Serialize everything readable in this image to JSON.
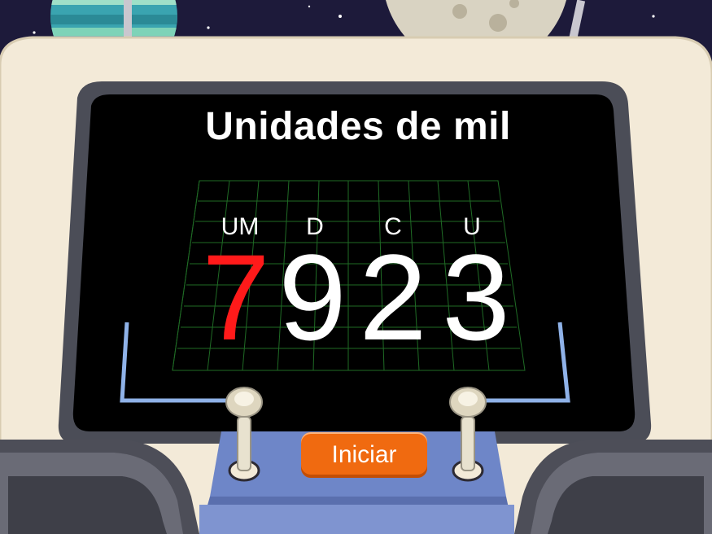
{
  "screen": {
    "title": "Unidades de mil"
  },
  "number": {
    "places": [
      {
        "label": "UM",
        "digit": "7",
        "highlighted": true
      },
      {
        "label": "D",
        "digit": "9",
        "highlighted": false
      },
      {
        "label": "C",
        "digit": "2",
        "highlighted": false
      },
      {
        "label": "U",
        "digit": "3",
        "highlighted": false
      }
    ],
    "highlight_color": "#ff1a1a",
    "digit_color": "#ffffff"
  },
  "controls": {
    "start_label": "Iniciar"
  },
  "colors": {
    "sky": "#1d1a3a",
    "console": "#f3ead8",
    "screen": "#000000",
    "grid": "#1f7a2a",
    "bracket": "#8fb2e8",
    "button": "#f06a10",
    "panel": "#6e86c8"
  }
}
